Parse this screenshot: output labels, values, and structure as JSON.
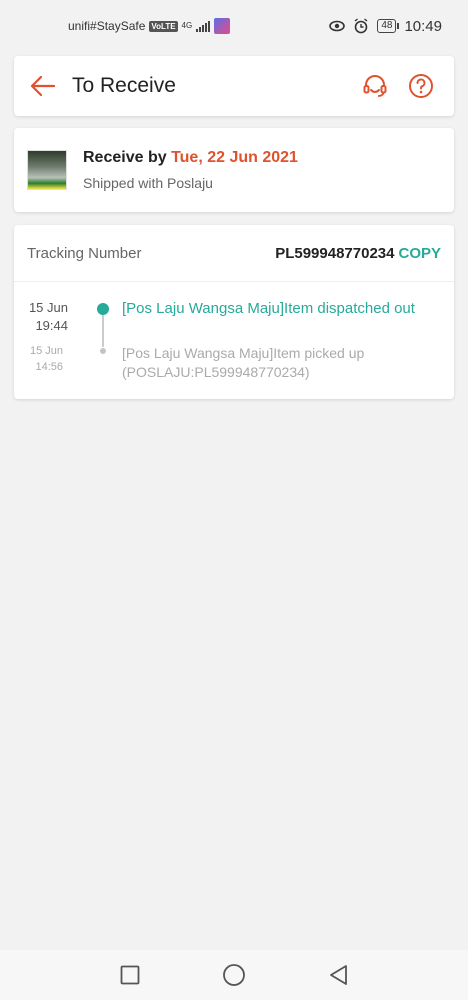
{
  "status_bar": {
    "carrier": "unifi#StaySafe",
    "volte": "VoLTE",
    "network": "4G",
    "battery": "48",
    "time": "10:49"
  },
  "header": {
    "title": "To Receive",
    "accent_color": "#e0522f"
  },
  "receive": {
    "label": "Receive by",
    "date": "Tue, 22 Jun 2021",
    "shipped_with": "Shipped with Poslaju"
  },
  "tracking": {
    "label": "Tracking Number",
    "number": "PL599948770234",
    "copy_label": "COPY",
    "accent_color": "#26aa99"
  },
  "timeline": [
    {
      "date": "15 Jun",
      "time": "19:44",
      "text": "[Pos Laju Wangsa Maju]Item dispatched out",
      "active": true
    },
    {
      "date": "15 Jun",
      "time": "14:56",
      "text": "[Pos Laju Wangsa Maju]Item picked up (POSLAJU:PL599948770234)",
      "active": false
    }
  ]
}
